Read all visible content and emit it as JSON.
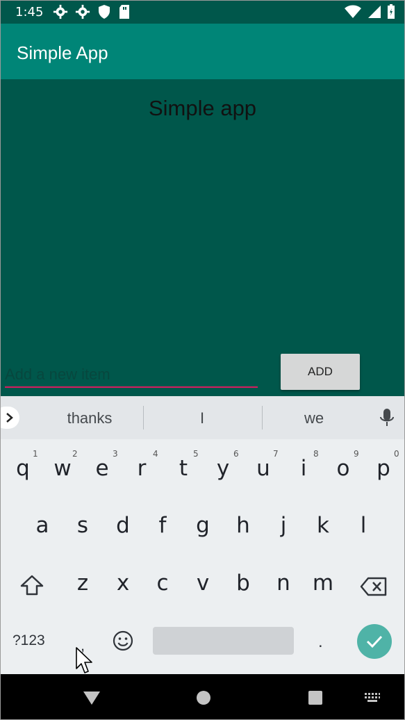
{
  "status_bar": {
    "time": "1:45"
  },
  "app_bar": {
    "title": "Simple App"
  },
  "content": {
    "title": "Simple app"
  },
  "input": {
    "placeholder": "Add a new item",
    "value": ""
  },
  "add_button": {
    "label": "ADD"
  },
  "keyboard": {
    "suggestions": [
      "thanks",
      "I",
      "we"
    ],
    "row1": [
      "q",
      "w",
      "e",
      "r",
      "t",
      "y",
      "u",
      "i",
      "o",
      "p"
    ],
    "row1_hints": [
      "1",
      "2",
      "3",
      "4",
      "5",
      "6",
      "7",
      "8",
      "9",
      "0"
    ],
    "row2": [
      "a",
      "s",
      "d",
      "f",
      "g",
      "h",
      "j",
      "k",
      "l"
    ],
    "row3": [
      "z",
      "x",
      "c",
      "v",
      "b",
      "n",
      "m"
    ],
    "symbols_label": "?123",
    "period_label": ".",
    "comma_label": ","
  },
  "colors": {
    "primary": "#008577",
    "primary_dark": "#00574b",
    "accent": "#d81b60"
  }
}
